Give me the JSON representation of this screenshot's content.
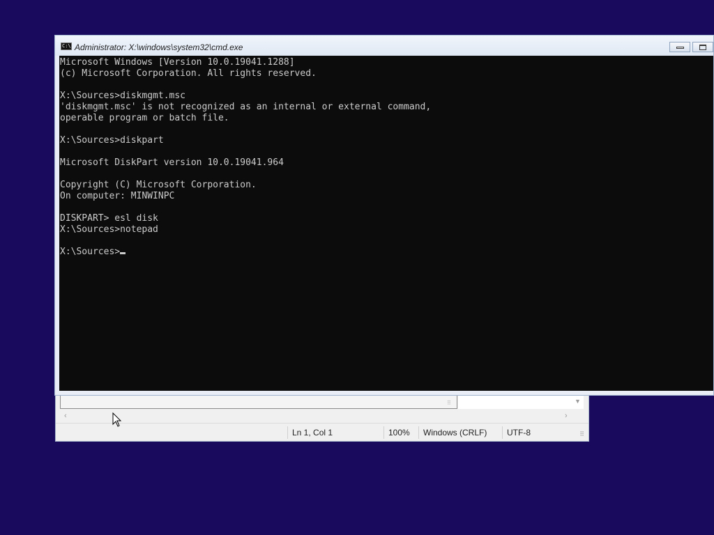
{
  "cmd_window": {
    "title": "Administrator: X:\\windows\\system32\\cmd.exe",
    "icon_label": "C:\\",
    "lines": [
      "Microsoft Windows [Version 10.0.19041.1288]",
      "(c) Microsoft Corporation. All rights reserved.",
      "",
      "X:\\Sources>diskmgmt.msc",
      "'diskmgmt.msc' is not recognized as an internal or external command,",
      "operable program or batch file.",
      "",
      "X:\\Sources>diskpart",
      "",
      "Microsoft DiskPart version 10.0.19041.964",
      "",
      "Copyright (C) Microsoft Corporation.",
      "On computer: MINWINPC",
      "",
      "DISKPART> esl disk",
      "X:\\Sources>notepad",
      ""
    ],
    "prompt": "X:\\Sources>"
  },
  "notepad_window": {
    "status_position": "Ln 1, Col 1",
    "status_zoom": "100%",
    "status_line_ending": "Windows (CRLF)",
    "status_encoding": "UTF-8"
  },
  "colors": {
    "desktop": "#1a0a5e",
    "console_bg": "#0c0c0c",
    "console_text": "#cccccc"
  }
}
